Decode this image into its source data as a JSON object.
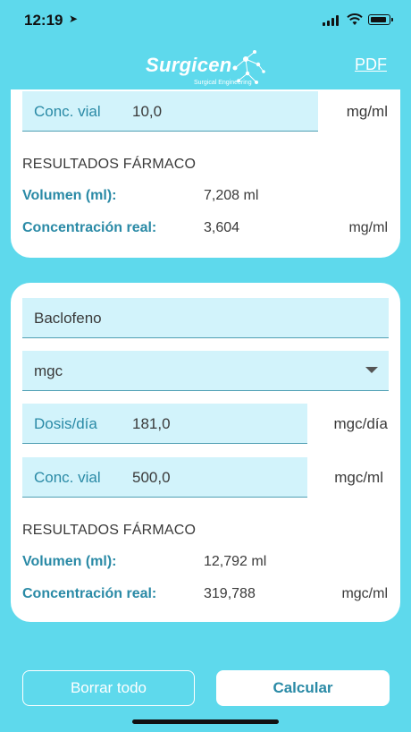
{
  "status_bar": {
    "time": "12:19"
  },
  "header": {
    "logo_text": "Surgicen",
    "logo_sub": "Surgical Engineering",
    "pdf_label": "PDF"
  },
  "card1": {
    "conc_label": "Conc. vial",
    "conc_value": "10,0",
    "conc_unit": "mg/ml",
    "results_title": "RESULTADOS FÁRMACO",
    "volume_label": "Volumen (ml):",
    "volume_value": "7,208 ml",
    "real_label": "Concentración real:",
    "real_value": "3,604",
    "real_unit": "mg/ml"
  },
  "card2": {
    "drug_name": "Baclofeno",
    "unit_select": "mgc",
    "dose_label": "Dosis/día",
    "dose_value": "181,0",
    "dose_unit": "mgc/día",
    "conc_label": "Conc. vial",
    "conc_value": "500,0",
    "conc_unit": "mgc/ml",
    "results_title": "RESULTADOS FÁRMACO",
    "volume_label": "Volumen (ml):",
    "volume_value": "12,792 ml",
    "real_label": "Concentración real:",
    "real_value": "319,788",
    "real_unit": "mgc/ml"
  },
  "buttons": {
    "clear": "Borrar todo",
    "calculate": "Calcular"
  }
}
